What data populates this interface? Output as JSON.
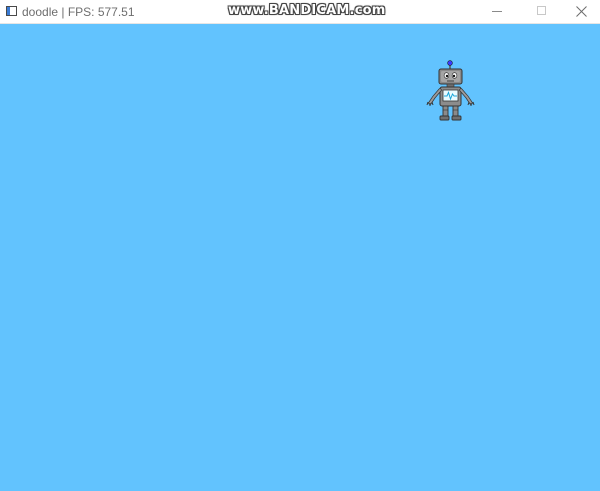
{
  "window": {
    "title": "doodle | FPS: 577.51",
    "watermark": "www.BANDICAM.com",
    "controls": {
      "minimize": "minimize",
      "maximize": "maximize",
      "close": "close"
    }
  },
  "scene": {
    "background_color": "#62c3fe",
    "sprite": "robot-icon"
  }
}
